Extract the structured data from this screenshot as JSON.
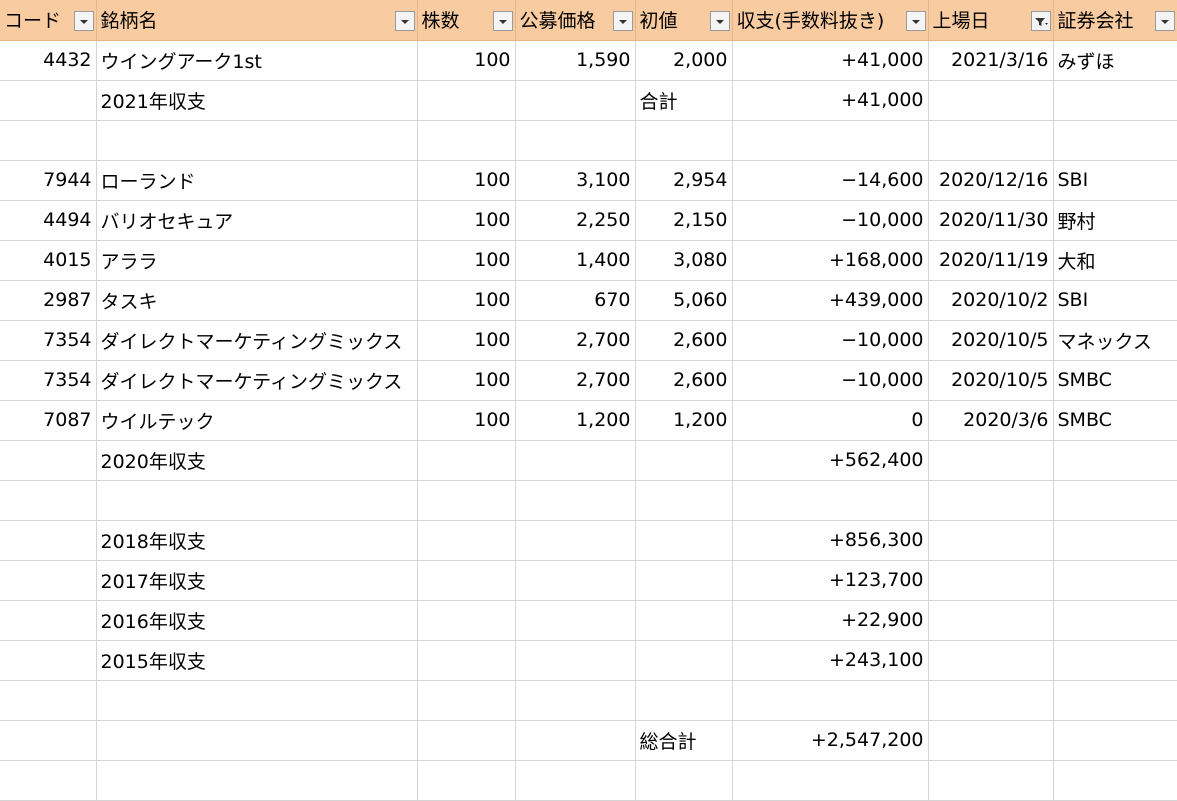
{
  "headers": [
    "コード",
    "銘柄名",
    "株数",
    "公募価格",
    "初値",
    "収支(手数料抜き)",
    "上場日",
    "証券会社"
  ],
  "filter_icons": [
    "dropdown",
    "dropdown",
    "dropdown",
    "dropdown",
    "dropdown",
    "dropdown",
    "filter-active",
    "dropdown"
  ],
  "rows": [
    {
      "code": "4432",
      "name": "ウイングアーク1st",
      "shares": "100",
      "ipo_price": "1,590",
      "first_price": "2,000",
      "profit": "+41,000",
      "listed": "2021/3/16",
      "broker": "みずほ"
    },
    {
      "code": "",
      "name": "2021年収支",
      "shares": "",
      "ipo_price": "",
      "first_price": "合計",
      "profit": "+41,000",
      "listed": "",
      "broker": ""
    },
    {
      "code": "",
      "name": "",
      "shares": "",
      "ipo_price": "",
      "first_price": "",
      "profit": "",
      "listed": "",
      "broker": ""
    },
    {
      "code": "7944",
      "name": "ローランド",
      "shares": "100",
      "ipo_price": "3,100",
      "first_price": "2,954",
      "profit": "−14,600",
      "listed": "2020/12/16",
      "broker": "SBI"
    },
    {
      "code": "4494",
      "name": "バリオセキュア",
      "shares": "100",
      "ipo_price": "2,250",
      "first_price": "2,150",
      "profit": "−10,000",
      "listed": "2020/11/30",
      "broker": "野村"
    },
    {
      "code": "4015",
      "name": "アララ",
      "shares": "100",
      "ipo_price": "1,400",
      "first_price": "3,080",
      "profit": "+168,000",
      "listed": "2020/11/19",
      "broker": "大和"
    },
    {
      "code": "2987",
      "name": "タスキ",
      "shares": "100",
      "ipo_price": "670",
      "first_price": "5,060",
      "profit": "+439,000",
      "listed": "2020/10/2",
      "broker": "SBI"
    },
    {
      "code": "7354",
      "name": "ダイレクトマーケティングミックス",
      "shares": "100",
      "ipo_price": "2,700",
      "first_price": "2,600",
      "profit": "−10,000",
      "listed": "2020/10/5",
      "broker": "マネックス"
    },
    {
      "code": "7354",
      "name": "ダイレクトマーケティングミックス",
      "shares": "100",
      "ipo_price": "2,700",
      "first_price": "2,600",
      "profit": "−10,000",
      "listed": "2020/10/5",
      "broker": "SMBC"
    },
    {
      "code": "7087",
      "name": "ウイルテック",
      "shares": "100",
      "ipo_price": "1,200",
      "first_price": "1,200",
      "profit": "0",
      "listed": "2020/3/6",
      "broker": "SMBC"
    },
    {
      "code": "",
      "name": "2020年収支",
      "shares": "",
      "ipo_price": "",
      "first_price": "",
      "profit": "+562,400",
      "listed": "",
      "broker": ""
    },
    {
      "code": "",
      "name": "",
      "shares": "",
      "ipo_price": "",
      "first_price": "",
      "profit": "",
      "listed": "",
      "broker": ""
    },
    {
      "code": "",
      "name": "2018年収支",
      "shares": "",
      "ipo_price": "",
      "first_price": "",
      "profit": "+856,300",
      "listed": "",
      "broker": ""
    },
    {
      "code": "",
      "name": "2017年収支",
      "shares": "",
      "ipo_price": "",
      "first_price": "",
      "profit": "+123,700",
      "listed": "",
      "broker": ""
    },
    {
      "code": "",
      "name": "2016年収支",
      "shares": "",
      "ipo_price": "",
      "first_price": "",
      "profit": "+22,900",
      "listed": "",
      "broker": ""
    },
    {
      "code": "",
      "name": "2015年収支",
      "shares": "",
      "ipo_price": "",
      "first_price": "",
      "profit": "+243,100",
      "listed": "",
      "broker": ""
    },
    {
      "code": "",
      "name": "",
      "shares": "",
      "ipo_price": "",
      "first_price": "",
      "profit": "",
      "listed": "",
      "broker": ""
    },
    {
      "code": "",
      "name": "",
      "shares": "",
      "ipo_price": "",
      "first_price": "総合計",
      "profit": "+2,547,200",
      "listed": "",
      "broker": ""
    },
    {
      "code": "",
      "name": "",
      "shares": "",
      "ipo_price": "",
      "first_price": "",
      "profit": "",
      "listed": "",
      "broker": ""
    }
  ]
}
